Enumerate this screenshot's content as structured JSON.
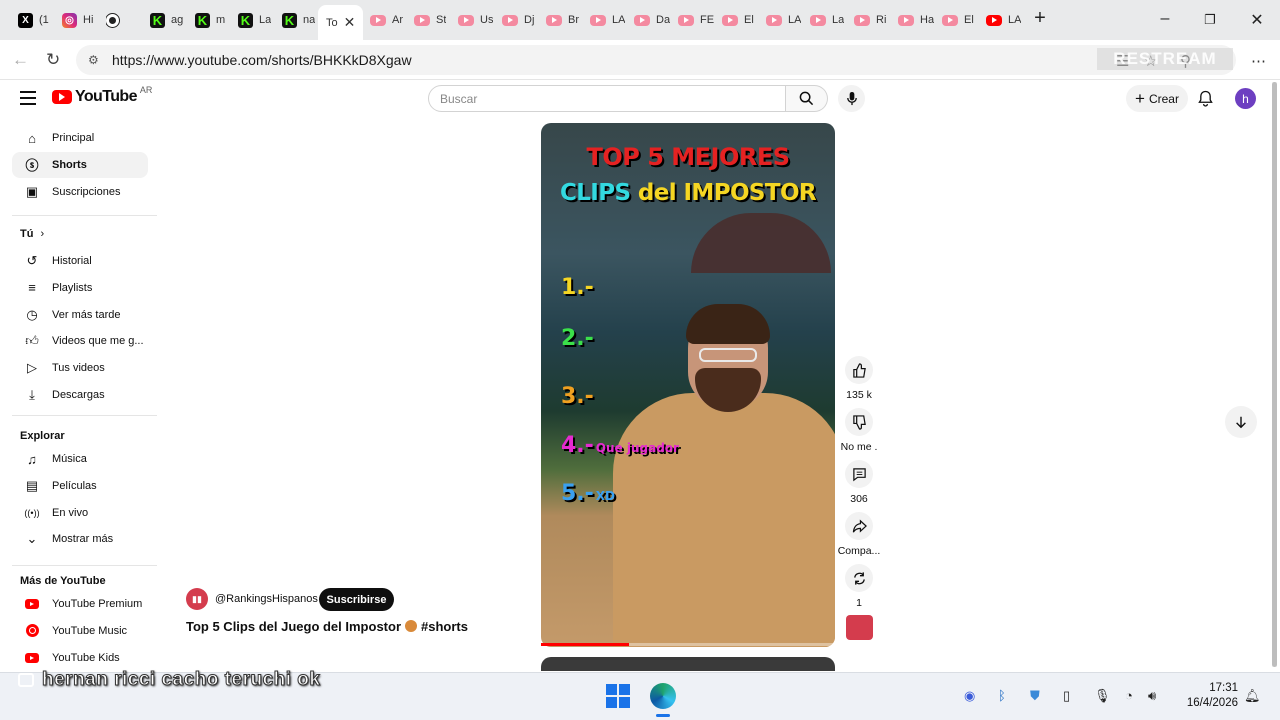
{
  "browser": {
    "tabs": [
      {
        "label": "(1",
        "favicon": "x-icon"
      },
      {
        "label": "Hi",
        "favicon": "instagram-icon"
      },
      {
        "label": "",
        "favicon": "circle-icon"
      },
      {
        "label": "ag",
        "favicon": "kick-icon"
      },
      {
        "label": "m",
        "favicon": "kick-icon"
      },
      {
        "label": "La",
        "favicon": "kick-icon"
      },
      {
        "label": "na",
        "favicon": "kick-icon"
      },
      {
        "label": "To",
        "favicon": "none",
        "active": true
      },
      {
        "label": "Ar",
        "favicon": "youtube-icon"
      },
      {
        "label": "St",
        "favicon": "youtube-icon"
      },
      {
        "label": "Us",
        "favicon": "youtube-icon"
      },
      {
        "label": "Dj",
        "favicon": "youtube-icon"
      },
      {
        "label": "Br",
        "favicon": "youtube-icon"
      },
      {
        "label": "LA",
        "favicon": "youtube-icon"
      },
      {
        "label": "Da",
        "favicon": "youtube-icon"
      },
      {
        "label": "FE",
        "favicon": "youtube-icon"
      },
      {
        "label": "El",
        "favicon": "youtube-icon"
      },
      {
        "label": "LA",
        "favicon": "youtube-icon"
      },
      {
        "label": "La",
        "favicon": "youtube-icon"
      },
      {
        "label": "Ri",
        "favicon": "youtube-icon"
      },
      {
        "label": "Ha",
        "favicon": "youtube-icon"
      },
      {
        "label": "El",
        "favicon": "youtube-icon"
      },
      {
        "label": "LA",
        "favicon": "youtube-icon"
      }
    ],
    "url": "https://www.youtube.com/shorts/BHKKkD8Xgaw",
    "watermark": "RESTREAM"
  },
  "header": {
    "logo_text": "YouTube",
    "country": "AR",
    "search_placeholder": "Buscar",
    "create_label": "Crear",
    "avatar_letter": "h"
  },
  "sidebar": {
    "main": [
      {
        "label": "Principal",
        "icon": "home-icon"
      },
      {
        "label": "Shorts",
        "icon": "shorts-icon",
        "active": true
      },
      {
        "label": "Suscripciones",
        "icon": "subscriptions-icon"
      }
    ],
    "you_section": "Tú",
    "you": [
      {
        "label": "Historial",
        "icon": "history-icon"
      },
      {
        "label": "Playlists",
        "icon": "playlists-icon"
      },
      {
        "label": "Ver más tarde",
        "icon": "watch-later-icon"
      },
      {
        "label": "Videos que me g...",
        "icon": "liked-icon"
      },
      {
        "label": "Tus videos",
        "icon": "your-videos-icon"
      },
      {
        "label": "Descargas",
        "icon": "download-icon"
      }
    ],
    "explore_section": "Explorar",
    "explore": [
      {
        "label": "Música",
        "icon": "music-icon"
      },
      {
        "label": "Películas",
        "icon": "movies-icon"
      },
      {
        "label": "En vivo",
        "icon": "live-icon"
      },
      {
        "label": "Mostrar más",
        "icon": "chevron-down-icon"
      }
    ],
    "more_section": "Más de YouTube",
    "more": [
      {
        "label": "YouTube Premium",
        "icon": "youtube-premium-icon"
      },
      {
        "label": "YouTube Music",
        "icon": "youtube-music-icon"
      },
      {
        "label": "YouTube Kids",
        "icon": "youtube-kids-icon"
      }
    ]
  },
  "short": {
    "overlay_title_line1": "TOP 5 MEJORES",
    "overlay_title_line2_a": "CLIPS ",
    "overlay_title_line2_b": "del IMPOSTOR",
    "ranks": [
      {
        "num": "1.-",
        "note": "",
        "color": "#f5d623"
      },
      {
        "num": "2.-",
        "note": "",
        "color": "#3be04a"
      },
      {
        "num": "3.-",
        "note": "",
        "color": "#f0a020"
      },
      {
        "num": "4.-",
        "note": "Que jugador",
        "color": "#e52ad0"
      },
      {
        "num": "5.-",
        "note": "XD",
        "color": "#3aa0f0"
      }
    ],
    "channel_handle": "@RankingsHispanos",
    "subscribe_label": "Suscribirse",
    "title": "Top 5 Clips del Juego del Impostor",
    "hashtag": "#shorts",
    "progress": 0.3
  },
  "actions": {
    "likes": "135 k",
    "dislike": "No me .",
    "comments": "306",
    "share": "Compa...",
    "remix": "1"
  },
  "taskbar": {
    "overlay_caption": "hernan ricci cacho teruchi ok",
    "time": "17:31",
    "date": "16/4/2026"
  }
}
